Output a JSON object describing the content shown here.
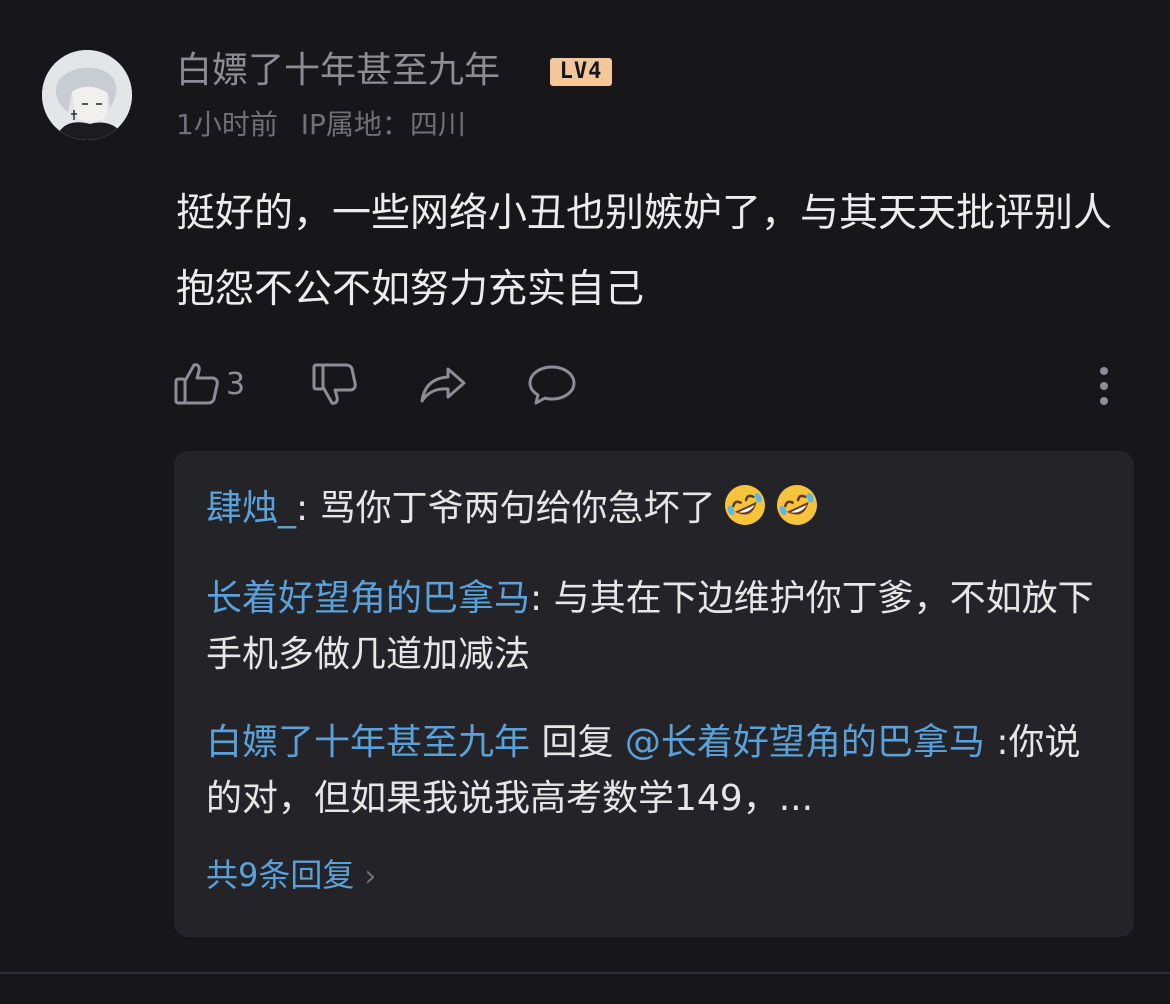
{
  "comment": {
    "username": "白嫖了十年甚至九年",
    "level": "LV4",
    "time": "1小时前",
    "ip_location": "IP属地：四川",
    "text": "挺好的，一些网络小丑也别嫉妒了，与其天天批评别人抱怨不公不如努力充实自己",
    "like_count": "3"
  },
  "replies": {
    "items": [
      {
        "author": "肆烛_",
        "separator": ": ",
        "text": "骂你丁爷两句给你急坏了",
        "emoji": "rolling-on-floor-laughing-emoji"
      },
      {
        "author": "长着好望角的巴拿马",
        "separator": ": ",
        "text": "与其在下边维护你丁爹，不如放下手机多做几道加减法"
      },
      {
        "author": "白嫖了十年甚至九年",
        "reply_word": " 回复 ",
        "mention": "@长着好望角的巴拿马",
        "separator": " :",
        "text": "你说的对，但如果我说我高考数学149，..."
      }
    ],
    "total_label": "共9条回复",
    "chevron": "›"
  },
  "colors": {
    "background": "#17171a",
    "reply_panel": "#242428",
    "link_blue": "#5aa1da",
    "muted": "#8d8d93",
    "level_badge": "#f3c79a"
  },
  "icons": [
    "thumbs-up-icon",
    "thumbs-down-icon",
    "share-icon",
    "comment-icon",
    "more-vertical-icon"
  ]
}
